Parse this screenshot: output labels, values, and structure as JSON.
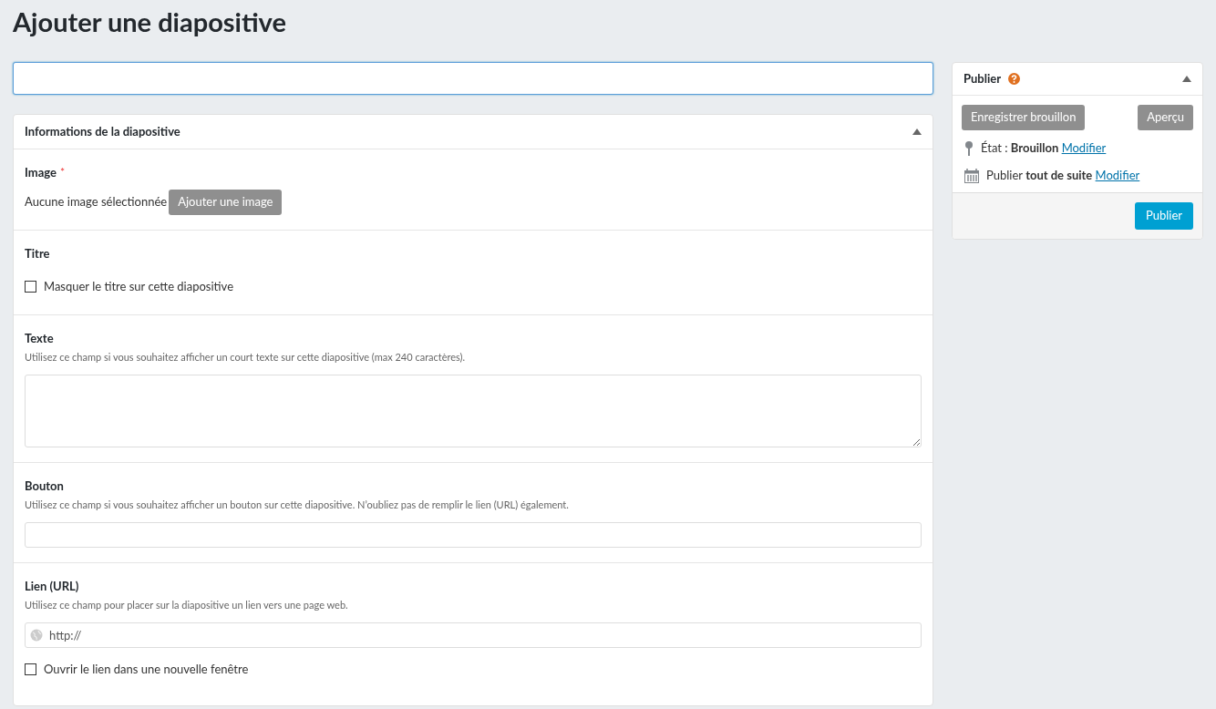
{
  "page_title": "Ajouter une diapositive",
  "title_field": {
    "focused": true
  },
  "main_box": {
    "title": "Informations de la diapositive",
    "expanded": true,
    "sections": [
      {
        "kind": "image",
        "label": "Image",
        "required_mark": "*",
        "status": "Aucune image sélectionnée",
        "button": {
          "label": "Ajouter une image",
          "disabled": true
        }
      },
      {
        "kind": "checkbox",
        "label": "Titre",
        "checkbox": {
          "label": "Masquer le titre sur cette diapositive",
          "checked": false
        }
      },
      {
        "kind": "textarea",
        "label": "Texte",
        "help": "Utilisez ce champ si vous souhaitez afficher un court texte sur cette diapositive (max 240 caractères)."
      },
      {
        "kind": "text",
        "label": "Bouton",
        "help": "Utilisez ce champ si vous souhaitez afficher un bouton sur cette diapositive. N’oubliez pas de remplir le lien (URL) également."
      },
      {
        "kind": "url",
        "label": "Lien (URL)",
        "help": "Utilisez ce champ pour placer sur la diapositive un lien vers une page web.",
        "placeholder": "http://",
        "checkbox": {
          "label": "Ouvrir le lien dans une nouvelle fenêtre",
          "checked": false
        }
      }
    ]
  },
  "publish_box": {
    "title": "Publier",
    "expanded": true,
    "buttons": [
      {
        "label": "Enregistrer brouillon",
        "disabled": true
      },
      {
        "label": "Aperçu",
        "disabled": true
      }
    ],
    "status_lines": [
      {
        "kind": "status",
        "text": "État : **Brouillon**",
        "link": "Modifier"
      },
      {
        "kind": "schedule",
        "text": "Publier **tout de suite**",
        "link": "Modifier"
      }
    ],
    "publish_button": {
      "label": "Publier",
      "disabled": false
    }
  }
}
